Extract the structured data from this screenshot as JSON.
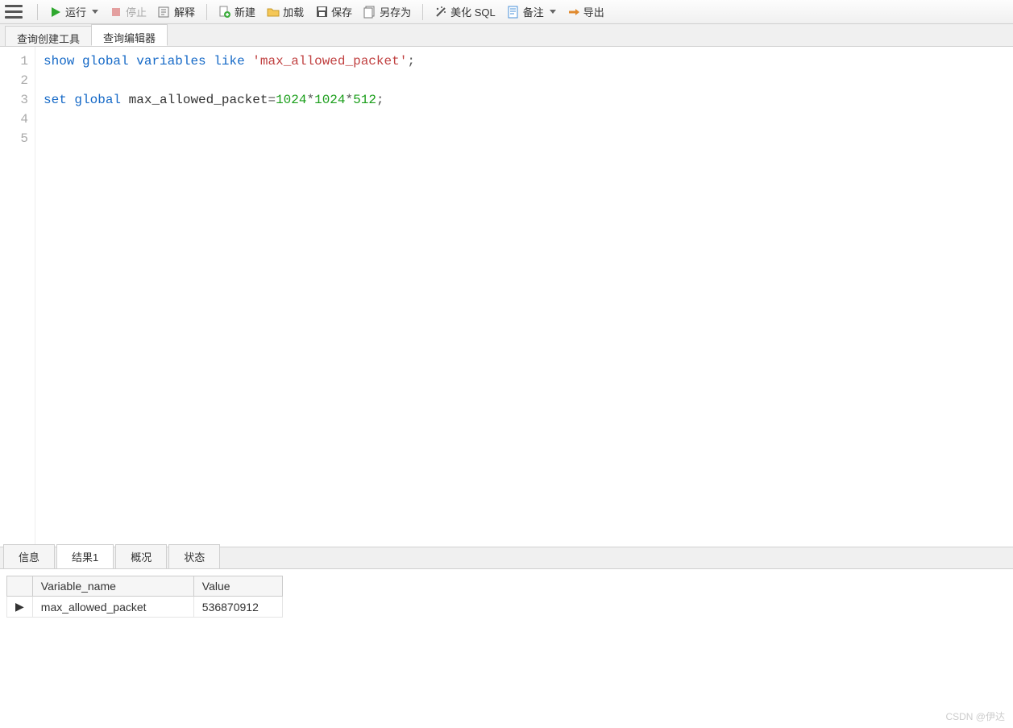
{
  "toolbar": {
    "run": "运行",
    "stop": "停止",
    "explain": "解释",
    "new": "新建",
    "load": "加载",
    "save": "保存",
    "saveas": "另存为",
    "beautify": "美化 SQL",
    "notes": "备注",
    "export": "导出"
  },
  "topTabs": {
    "builder": "查询创建工具",
    "editor": "查询编辑器"
  },
  "code": {
    "lines": [
      {
        "n": "1",
        "tokens": [
          {
            "t": "kw",
            "v": "show"
          },
          {
            "t": "sp",
            "v": " "
          },
          {
            "t": "kw",
            "v": "global"
          },
          {
            "t": "sp",
            "v": " "
          },
          {
            "t": "kw",
            "v": "variables"
          },
          {
            "t": "sp",
            "v": " "
          },
          {
            "t": "kw",
            "v": "like"
          },
          {
            "t": "sp",
            "v": " "
          },
          {
            "t": "str",
            "v": "'max_allowed_packet'"
          },
          {
            "t": "punct",
            "v": ";"
          }
        ]
      },
      {
        "n": "2",
        "tokens": []
      },
      {
        "n": "3",
        "tokens": [
          {
            "t": "kw",
            "v": "set"
          },
          {
            "t": "sp",
            "v": " "
          },
          {
            "t": "kw",
            "v": "global"
          },
          {
            "t": "sp",
            "v": " "
          },
          {
            "t": "txt",
            "v": "max_allowed_packet"
          },
          {
            "t": "punct",
            "v": "="
          },
          {
            "t": "num",
            "v": "1024"
          },
          {
            "t": "punct",
            "v": "*"
          },
          {
            "t": "num",
            "v": "1024"
          },
          {
            "t": "punct",
            "v": "*"
          },
          {
            "t": "num",
            "v": "512"
          },
          {
            "t": "punct",
            "v": ";"
          }
        ]
      },
      {
        "n": "4",
        "tokens": []
      },
      {
        "n": "5",
        "tokens": []
      }
    ]
  },
  "bottomTabs": {
    "info": "信息",
    "result1": "结果1",
    "profile": "概况",
    "status": "状态"
  },
  "result": {
    "columns": [
      "Variable_name",
      "Value"
    ],
    "rows": [
      {
        "variable": "max_allowed_packet",
        "value": "536870912"
      }
    ]
  },
  "watermark": "CSDN @伊达"
}
